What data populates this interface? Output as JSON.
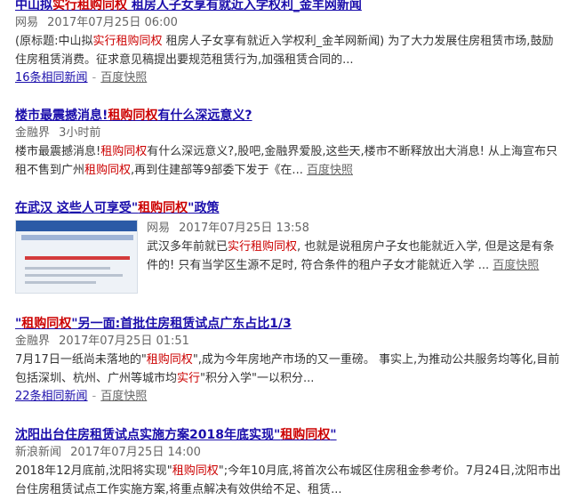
{
  "results": [
    {
      "title_parts": [
        {
          "t": "中山拟",
          "hl": false
        },
        {
          "t": "实行租购同权",
          "hl": true
        },
        {
          "t": " 租房人子女享有就近入学权利_金羊网新闻",
          "hl": false
        }
      ],
      "source": "网易",
      "time": "2017年07月25日 06:00",
      "abstract_parts": [
        {
          "t": "(原标题:中山拟",
          "hl": false
        },
        {
          "t": "实行租购同权",
          "hl": true
        },
        {
          "t": " 租房人子女享有就近入学权利_金羊网新闻) 为了大力发展住房租赁市场,鼓励住房租赁消费。征求意见稿提出要规范租赁行为,加强租赁合同的...",
          "hl": false
        }
      ],
      "related": "16条相同新闻",
      "sep": "-",
      "snapshot": "百度快照"
    },
    {
      "title_parts": [
        {
          "t": "楼市最震撼消息!",
          "hl": false
        },
        {
          "t": "租购同权",
          "hl": true
        },
        {
          "t": "有什么深远意义?",
          "hl": false
        }
      ],
      "source": "金融界",
      "time": "3小时前",
      "abstract_parts": [
        {
          "t": "楼市最震撼消息!",
          "hl": false
        },
        {
          "t": "租购同权",
          "hl": true
        },
        {
          "t": "有什么深远意义?,股吧,金融界爱股,这些天,楼市不断释放出大消息! 从上海宣布只租不售到广州",
          "hl": false
        },
        {
          "t": "租购同权",
          "hl": true
        },
        {
          "t": ",再到住建部等9部委下发于《在... ",
          "hl": false
        }
      ],
      "snapshot": "百度快照"
    },
    {
      "title_parts": [
        {
          "t": "在武汉 这些人可享受\"",
          "hl": false
        },
        {
          "t": "租购同权",
          "hl": true
        },
        {
          "t": "\"政策",
          "hl": false
        }
      ],
      "source": "网易",
      "time": "2017年07月25日 13:58",
      "abstract_parts": [
        {
          "t": "武汉多年前就已",
          "hl": false
        },
        {
          "t": "实行租购同权",
          "hl": true
        },
        {
          "t": ", 也就是说租房户子女也能就近入学, 但是这是有条件的! 只有当学区生源不足时, 符合条件的租户子女才能就近入学 ... ",
          "hl": false
        }
      ],
      "snapshot": "百度快照"
    },
    {
      "title_parts": [
        {
          "t": "\"",
          "hl": false
        },
        {
          "t": "租购同权",
          "hl": true
        },
        {
          "t": "\"另一面:首批住房租赁试点广东占比1/3",
          "hl": false
        }
      ],
      "source": "金融界",
      "time": "2017年07月25日 01:51",
      "abstract_parts": [
        {
          "t": "7月17日一纸尚未落地的\"",
          "hl": false
        },
        {
          "t": "租购同权",
          "hl": true
        },
        {
          "t": "\",成为今年房地产市场的又一重磅。 事实上,为推动公共服务均等化,目前包括深圳、杭州、广州等城市均",
          "hl": false
        },
        {
          "t": "实行",
          "hl": true
        },
        {
          "t": "\"积分入学\"一以积分...",
          "hl": false
        }
      ],
      "related": "22条相同新闻",
      "sep": "-",
      "snapshot": "百度快照"
    },
    {
      "title_parts": [
        {
          "t": "沈阳出台住房租赁试点实施方案2018年底实现\"",
          "hl": false
        },
        {
          "t": "租购同权",
          "hl": true
        },
        {
          "t": "\"",
          "hl": false
        }
      ],
      "source": "新浪新闻",
      "time": "2017年07月25日 14:00",
      "abstract_parts": [
        {
          "t": "2018年12月底前,沈阳将实现\"",
          "hl": false
        },
        {
          "t": "租购同权",
          "hl": true
        },
        {
          "t": "\";今年10月底,将首次公布城区住房租金参考价。7月24日,沈阳市出台住房租赁试点工作实施方案,将重点解决有效供给不足、租赁...",
          "hl": false
        }
      ]
    }
  ],
  "colors": {
    "link": "#1a0dab",
    "highlight": "#cc0000",
    "meta": "#666666"
  }
}
